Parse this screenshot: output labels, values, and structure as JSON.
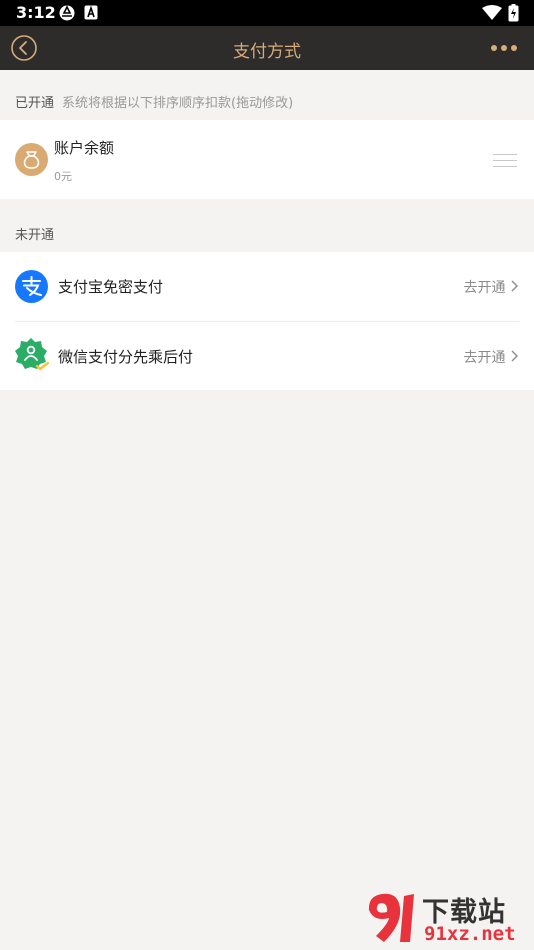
{
  "status_bar": {
    "time": "3:12"
  },
  "header": {
    "title": "支付方式"
  },
  "enabled_section": {
    "label": "已开通",
    "hint": "系统将根据以下排序顺序扣款(拖动修改)",
    "items": [
      {
        "name": "账户余额",
        "sub": "0元",
        "icon": "money-bag-icon"
      }
    ]
  },
  "disabled_section": {
    "label": "未开通",
    "items": [
      {
        "name": "支付宝免密支付",
        "action": "去开通",
        "icon": "alipay-icon"
      },
      {
        "name": "微信支付分先乘后付",
        "action": "去开通",
        "icon": "wechat-pay-score-icon"
      }
    ]
  },
  "watermark": {
    "brand": "下载站",
    "url": "91xz.net"
  },
  "colors": {
    "accent": "#d7ac7c",
    "header_bg": "#2e2c2a",
    "alipay": "#1678ff",
    "wechat": "#2aae67"
  }
}
